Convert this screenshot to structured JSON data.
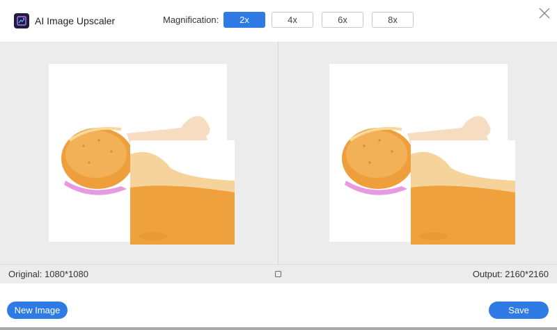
{
  "header": {
    "app_title": "AI Image Upscaler",
    "magnification_label": "Magnification:",
    "magnification_options": [
      "2x",
      "4x",
      "6x",
      "8x"
    ],
    "selected": "2x"
  },
  "info": {
    "original_label": "Original: 1080*1080",
    "output_label": "Output: 2160*2160"
  },
  "footer": {
    "new_image_label": "New Image",
    "save_label": "Save"
  },
  "colors": {
    "accent": "#2f7be5",
    "preview_bg": "#ececec"
  },
  "icons": {
    "app_logo": "app-logo-icon",
    "close": "close-icon",
    "compare": "compare-toggle-icon"
  }
}
